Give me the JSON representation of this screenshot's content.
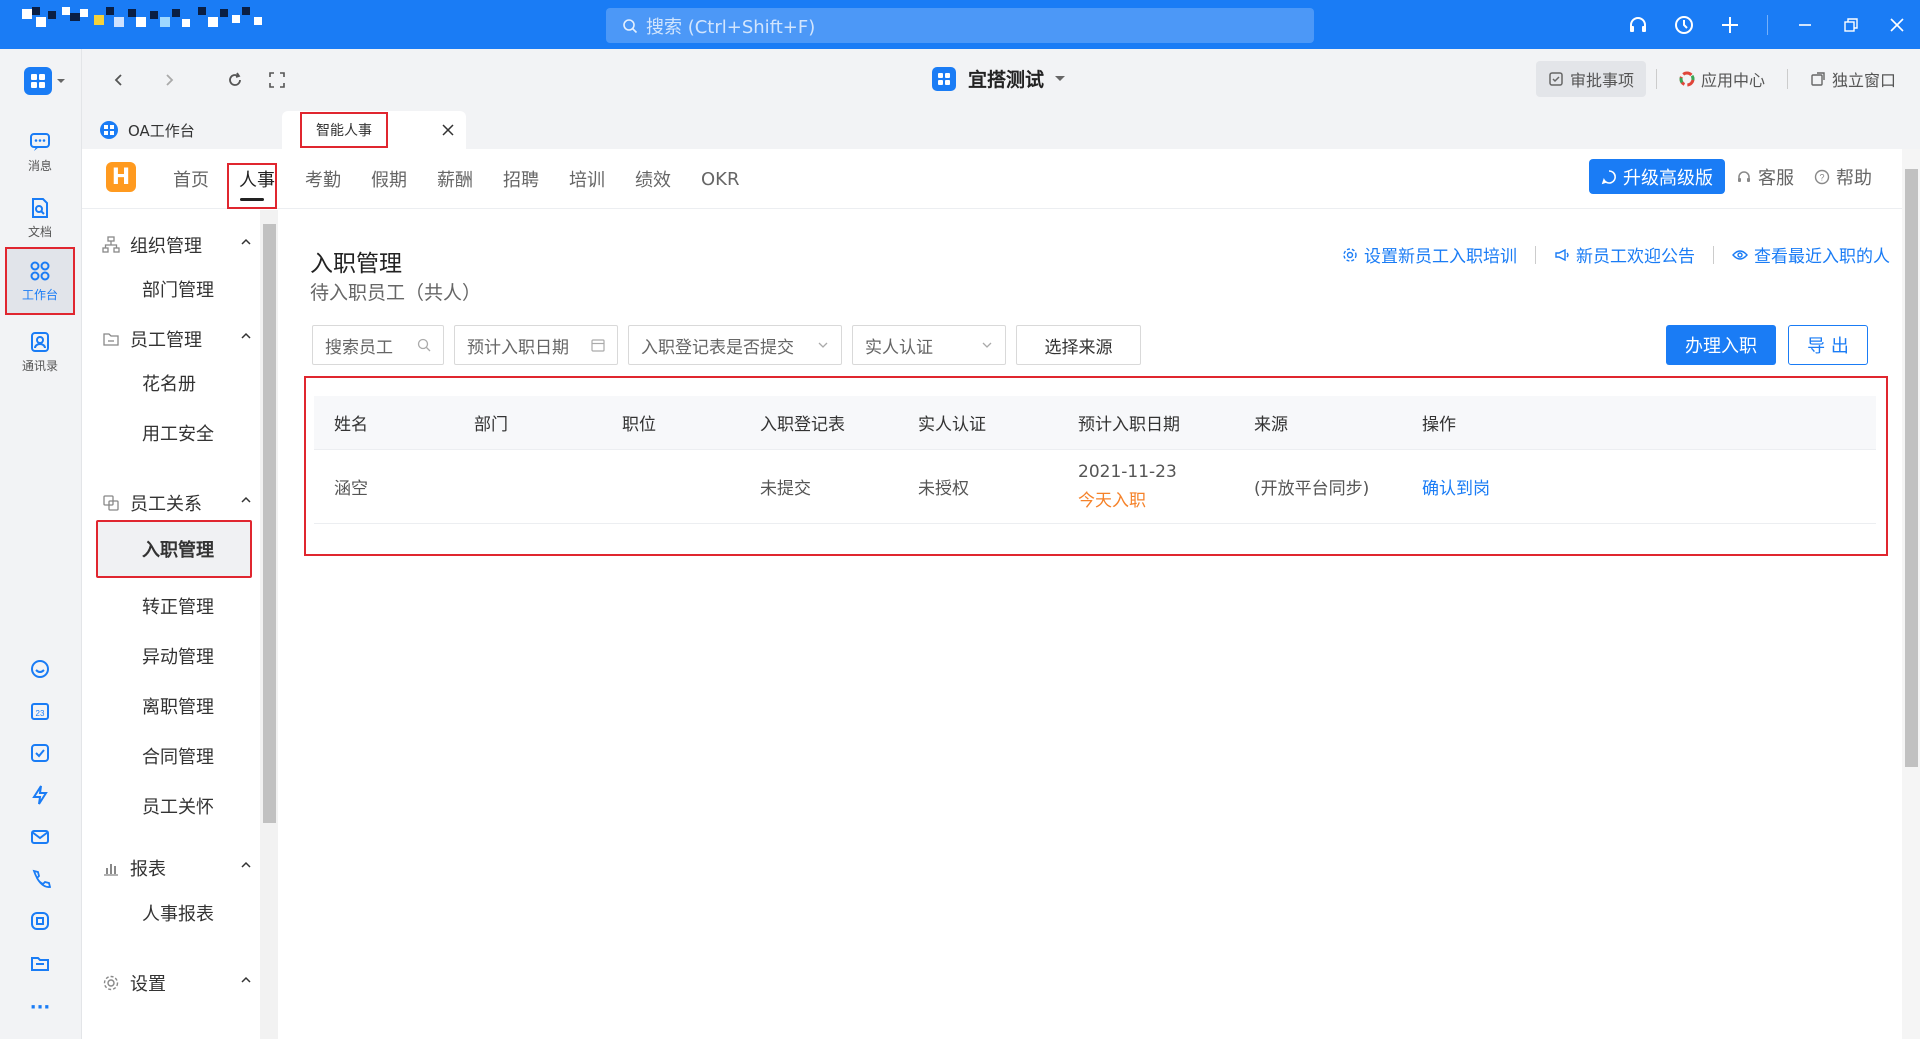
{
  "topbar": {
    "search_placeholder": "搜索 (Ctrl+Shift+F)",
    "colors": {
      "bar": "#1a7cf5"
    },
    "icons": [
      "headset-icon",
      "history-icon",
      "plus-icon",
      "minimize-icon",
      "restore-icon",
      "close-icon"
    ]
  },
  "rail": {
    "items": [
      {
        "label": "消息",
        "icon": "message-icon"
      },
      {
        "label": "文档",
        "icon": "document-icon"
      },
      {
        "label": "工作台",
        "icon": "workbench-icon"
      },
      {
        "label": "通讯录",
        "icon": "contacts-icon"
      }
    ],
    "more": "···"
  },
  "toolbar": {
    "title": "宜搭测试",
    "approvals": "审批事项",
    "app_center": "应用中心",
    "standalone": "独立窗口"
  },
  "tabs": [
    {
      "label": "OA工作台"
    },
    {
      "label": "智能人事"
    }
  ],
  "appnav": {
    "logo": "H",
    "items": [
      "首页",
      "人事",
      "考勤",
      "假期",
      "薪酬",
      "招聘",
      "培训",
      "绩效",
      "OKR"
    ],
    "active": "人事",
    "upgrade": "升级高级版",
    "service": "客服",
    "help": "帮助"
  },
  "sidebar": {
    "groups": [
      {
        "label": "组织管理",
        "items": [
          "部门管理"
        ]
      },
      {
        "label": "员工管理",
        "items": [
          "花名册",
          "用工安全"
        ]
      },
      {
        "label": "员工关系",
        "items": [
          "入职管理",
          "转正管理",
          "异动管理",
          "离职管理",
          "合同管理",
          "员工关怀"
        ]
      },
      {
        "label": "报表",
        "items": [
          "人事报表"
        ]
      },
      {
        "label": "设置",
        "items": []
      }
    ],
    "active": "入职管理"
  },
  "content": {
    "title": "入职管理",
    "subtitle": "待入职员工（共人）",
    "links": [
      "设置新员工入职培训",
      "新员工欢迎公告",
      "查看最近入职的人"
    ],
    "filters": {
      "search_placeholder": "搜索员工",
      "date": "预计入职日期",
      "form_submitted": "入职登记表是否提交",
      "verify": "实人认证",
      "source": "选择来源"
    },
    "primary_btn": "办理入职",
    "export_btn": "导 出",
    "table": {
      "columns": [
        "姓名",
        "部门",
        "职位",
        "入职登记表",
        "实人认证",
        "预计入职日期",
        "来源",
        "操作"
      ],
      "rows": [
        {
          "name": "涵空",
          "dept": "",
          "position": "",
          "form": "未提交",
          "verify": "未授权",
          "date": "2021-11-23",
          "date_note": "今天入职",
          "source": "(开放平台同步)",
          "action": "确认到岗"
        }
      ]
    }
  }
}
